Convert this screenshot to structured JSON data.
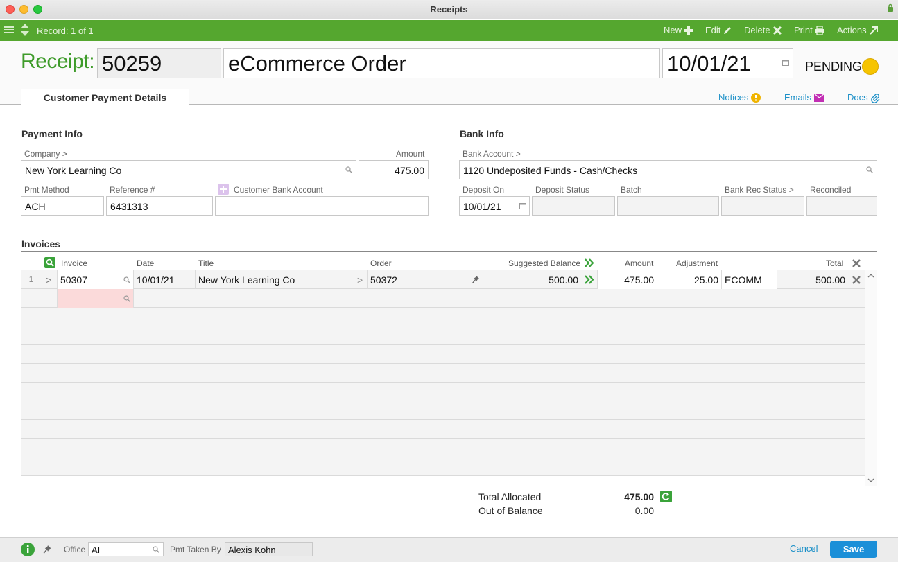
{
  "window": {
    "title": "Receipts"
  },
  "toolbar": {
    "record_info": "Record: 1 of 1",
    "new_label": "New",
    "edit_label": "Edit",
    "delete_label": "Delete",
    "print_label": "Print",
    "actions_label": "Actions"
  },
  "header": {
    "receipt_label": "Receipt:",
    "receipt_number": "50259",
    "description": "eCommerce Order",
    "date": "10/01/21",
    "status": "PENDING",
    "status_color": "#f6c400"
  },
  "tabs": {
    "active": "Customer Payment Details",
    "notices": "Notices",
    "emails": "Emails",
    "docs": "Docs"
  },
  "payment_info": {
    "title": "Payment Info",
    "company_label": "Company >",
    "company_value": "New York Learning Co",
    "amount_label": "Amount",
    "amount_value": "475.00",
    "pmt_method_label": "Pmt Method",
    "pmt_method_value": "ACH",
    "reference_label": "Reference #",
    "reference_value": "6431313",
    "customer_bank_label": "Customer Bank Account",
    "customer_bank_value": ""
  },
  "bank_info": {
    "title": "Bank Info",
    "bank_account_label": "Bank Account >",
    "bank_account_value": "1120 Undeposited Funds - Cash/Checks",
    "deposit_on_label": "Deposit On",
    "deposit_on_value": "10/01/21",
    "deposit_status_label": "Deposit Status",
    "batch_label": "Batch",
    "bank_rec_status_label": "Bank Rec Status >",
    "reconciled_label": "Reconciled"
  },
  "invoices": {
    "title": "Invoices",
    "headers": {
      "invoice": "Invoice",
      "date": "Date",
      "title": "Title",
      "order": "Order",
      "suggested_balance": "Suggested Balance",
      "amount": "Amount",
      "adjustment": "Adjustment",
      "total": "Total"
    },
    "rows": [
      {
        "num": "1",
        "invoice": "50307",
        "date": "10/01/21",
        "title": "New York Learning Co",
        "order": "50372",
        "suggested_balance": "500.00",
        "amount": "475.00",
        "adjustment": "25.00",
        "adj_code": "ECOMM",
        "total": "500.00"
      }
    ]
  },
  "totals": {
    "allocated_label": "Total Allocated",
    "allocated_value": "475.00",
    "out_of_balance_label": "Out of Balance",
    "out_of_balance_value": "0.00"
  },
  "footer": {
    "office_label": "Office",
    "office_value": "AI",
    "pmt_taken_by_label": "Pmt Taken By",
    "pmt_taken_by_value": "Alexis Kohn",
    "cancel_label": "Cancel",
    "save_label": "Save"
  },
  "colors": {
    "toolbar_green": "#55a72f",
    "accent_blue": "#1b8fd8",
    "receipt_green": "#3e9b2a"
  }
}
